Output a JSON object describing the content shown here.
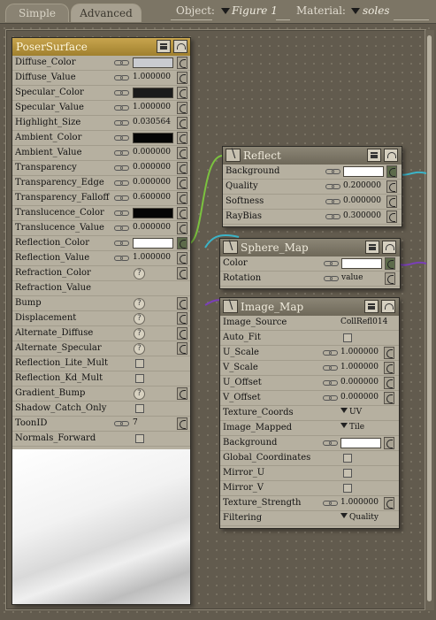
{
  "tabs": [
    {
      "label": "Simple",
      "active": false
    },
    {
      "label": "Advanced",
      "active": true
    }
  ],
  "header": {
    "object_label": "Object:",
    "object_value": "Figure 1",
    "material_label": "Material:",
    "material_value": "soles"
  },
  "colors": {
    "root_title": "#b8963e",
    "wire_cyan": "#3bb4c8",
    "wire_green": "#7bc23f",
    "wire_purple": "#7a3fb8"
  },
  "poser_surface": {
    "title": "PoserSurface",
    "rows": [
      {
        "label": "Diffuse_Color",
        "swatch": "#c9cbd0"
      },
      {
        "label": "Diffuse_Value",
        "value": "1.000000"
      },
      {
        "label": "Specular_Color",
        "swatch": "#1b1b1b"
      },
      {
        "label": "Specular_Value",
        "value": "1.000000"
      },
      {
        "label": "Highlight_Size",
        "value": "0.030564"
      },
      {
        "label": "Ambient_Color",
        "swatch": "#050505"
      },
      {
        "label": "Ambient_Value",
        "value": "0.000000"
      },
      {
        "label": "Transparency",
        "value": "0.000000"
      },
      {
        "label": "Transparency_Edge",
        "value": "0.000000"
      },
      {
        "label": "Transparency_Falloff",
        "value": "0.600000"
      },
      {
        "label": "Translucence_Color",
        "swatch": "#050505"
      },
      {
        "label": "Translucence_Value",
        "value": "0.000000"
      },
      {
        "label": "Reflection_Color",
        "swatch": "#ffffff"
      },
      {
        "label": "Reflection_Value",
        "value": "1.000000"
      },
      {
        "label": "Refraction_Color"
      },
      {
        "label": "Refraction_Value"
      },
      {
        "label": "Bump"
      },
      {
        "label": "Displacement"
      },
      {
        "label": "Alternate_Diffuse"
      },
      {
        "label": "Alternate_Specular"
      },
      {
        "label": "Reflection_Lite_Mult"
      },
      {
        "label": "Reflection_Kd_Mult"
      },
      {
        "label": "Gradient_Bump"
      },
      {
        "label": "Shadow_Catch_Only"
      },
      {
        "label": "ToonID",
        "value": "7"
      },
      {
        "label": "Normals_Forward"
      }
    ]
  },
  "reflect": {
    "title": "Reflect",
    "rows": [
      {
        "label": "Background",
        "swatch": "#ffffff"
      },
      {
        "label": "Quality",
        "value": "0.200000"
      },
      {
        "label": "Softness",
        "value": "0.000000"
      },
      {
        "label": "RayBias",
        "value": "0.300000"
      }
    ]
  },
  "sphere_map": {
    "title": "Sphere_Map",
    "rows": [
      {
        "label": "Color",
        "swatch": "#ffffff"
      },
      {
        "label": "Rotation",
        "value": "value"
      }
    ]
  },
  "image_map": {
    "title": "Image_Map",
    "rows": [
      {
        "label": "Image_Source",
        "value": "CollRefl014"
      },
      {
        "label": "Auto_Fit"
      },
      {
        "label": "U_Scale",
        "value": "1.000000"
      },
      {
        "label": "V_Scale",
        "value": "1.000000"
      },
      {
        "label": "U_Offset",
        "value": "0.000000"
      },
      {
        "label": "V_Offset",
        "value": "0.000000"
      },
      {
        "label": "Texture_Coords",
        "value": "UV"
      },
      {
        "label": "Image_Mapped",
        "value": "Tile"
      },
      {
        "label": "Background",
        "swatch": "#ffffff"
      },
      {
        "label": "Global_Coordinates"
      },
      {
        "label": "Mirror_U"
      },
      {
        "label": "Mirror_V"
      },
      {
        "label": "Texture_Strength",
        "value": "1.000000"
      },
      {
        "label": "Filtering",
        "value": "Quality"
      }
    ]
  }
}
